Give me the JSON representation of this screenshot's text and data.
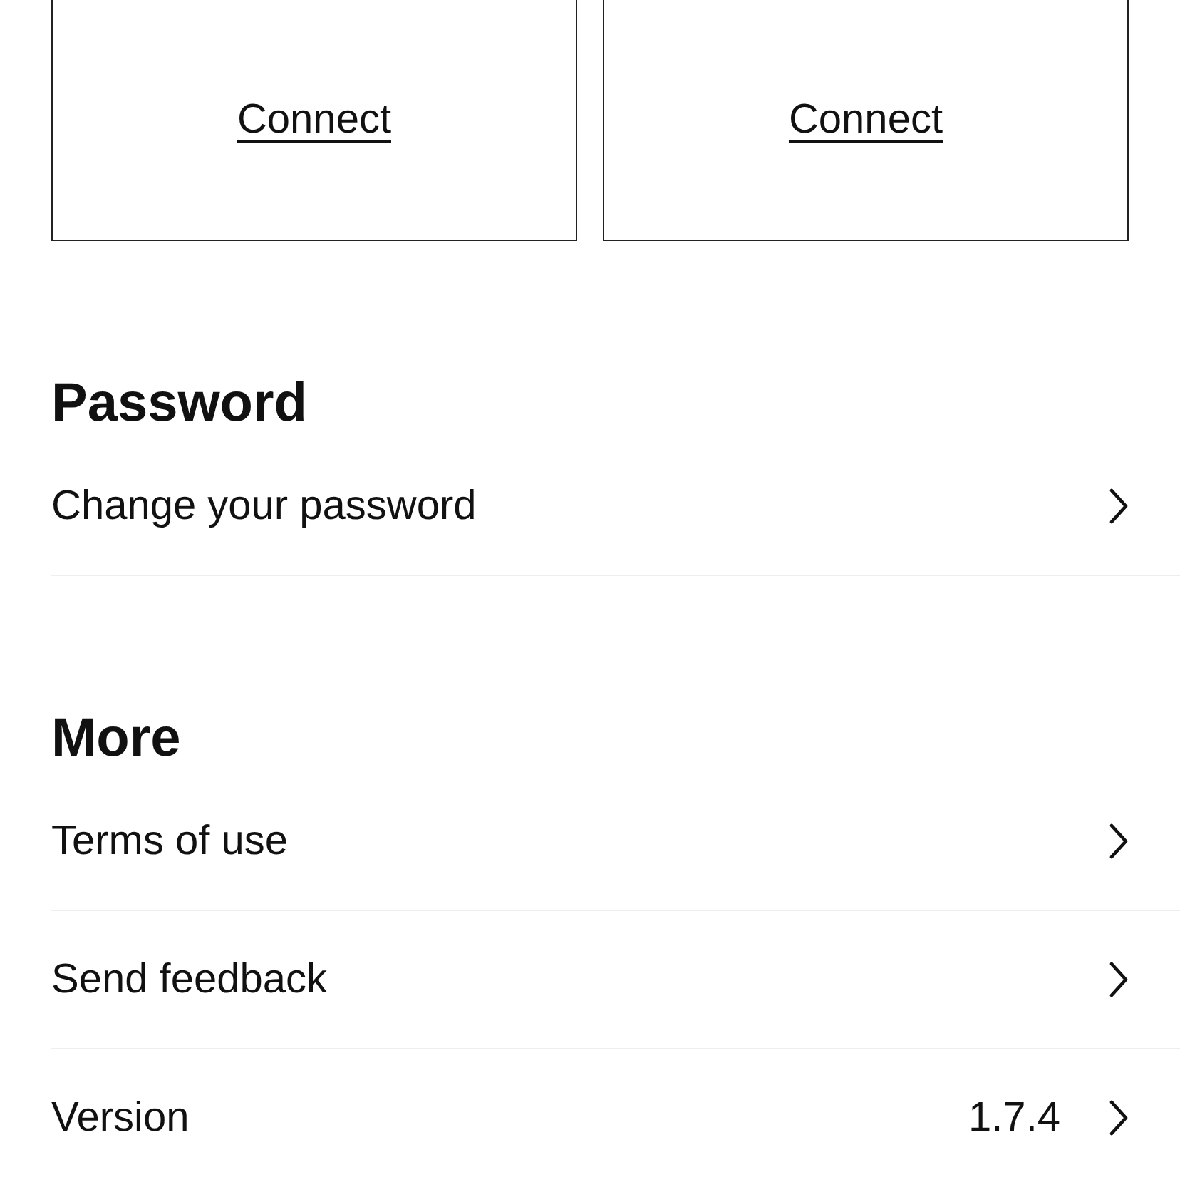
{
  "cards": [
    {
      "label": "Connect"
    },
    {
      "label": "Connect"
    }
  ],
  "sections": [
    {
      "title": "Password",
      "rows": [
        {
          "label": "Change your password"
        }
      ]
    },
    {
      "title": "More",
      "rows": [
        {
          "label": "Terms of use"
        },
        {
          "label": "Send feedback"
        },
        {
          "label": "Version",
          "value": "1.7.4"
        }
      ]
    }
  ]
}
